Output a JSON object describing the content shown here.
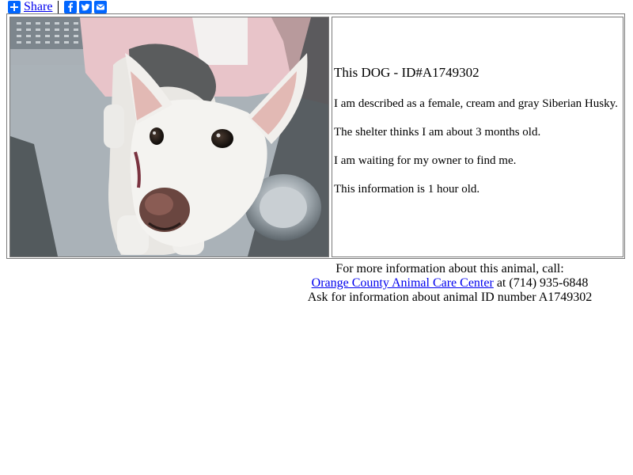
{
  "share": {
    "label": "Share",
    "icons": [
      "facebook-icon",
      "twitter-icon",
      "email-icon"
    ]
  },
  "animal": {
    "title": "This DOG - ID#A1749302",
    "description": "I am described as a female, cream and gray Siberian Husky.",
    "age": "The shelter thinks I am about 3 months old.",
    "waiting": "I am waiting for my owner to find me.",
    "freshness": "This information is 1 hour old."
  },
  "footer": {
    "line1": "For more information about this animal, call:",
    "shelter_link": "Orange County Animal Care Center",
    "phone_text": " at (714) 935-6848",
    "line3": "Ask for information about animal ID number A1749302"
  },
  "colors": {
    "share_blue": "#0166ff",
    "link_blue": "#0000ee",
    "border_gray": "#7a7a7a"
  }
}
